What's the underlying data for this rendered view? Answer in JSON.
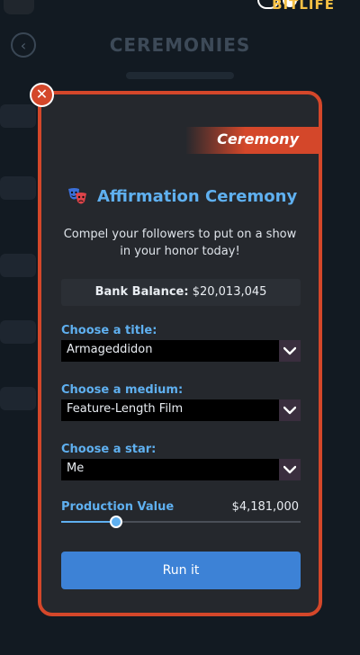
{
  "background": {
    "logo": "BITLIFE",
    "page_title": "CEREMONIES"
  },
  "modal": {
    "badge": "Ceremony",
    "title": "Affirmation Ceremony",
    "description": "Compel your followers to put on a show in your honor today!",
    "balance_label": "Bank Balance:",
    "balance_value": "$20,013,045",
    "fields": [
      {
        "label": "Choose a title:",
        "value": "Armageddidon"
      },
      {
        "label": "Choose a medium:",
        "value": "Feature-Length Film"
      },
      {
        "label": "Choose a star:",
        "value": "Me"
      }
    ],
    "production_label": "Production Value",
    "production_value": "$4,181,000",
    "production_slider_fraction": 0.23,
    "run_label": "Run it"
  },
  "icons": {
    "close": "close-icon",
    "theater": "theater-masks-icon",
    "caret": "chevron-down-icon"
  },
  "colors": {
    "accent_orange": "#d4472a",
    "label_blue": "#5fb0f0",
    "button_blue": "#3d82d6",
    "panel": "#25282d"
  }
}
